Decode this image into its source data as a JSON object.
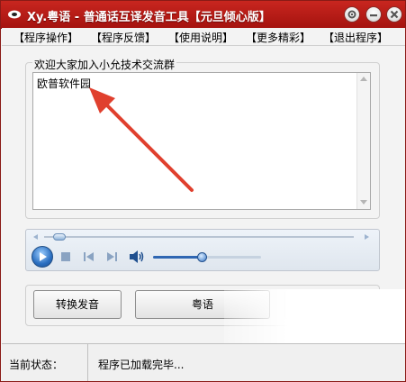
{
  "window": {
    "title": "Xy.粤语 - 普通话互译发音工具【元旦倾心版】",
    "accent_color": "#b51b16",
    "controls": [
      "settings-icon",
      "minimize-icon",
      "close-icon"
    ]
  },
  "menu": {
    "items": [
      "【程序操作】",
      "【程序反馈】",
      "【使用说明】",
      "【更多精彩】",
      "【退出程序】"
    ]
  },
  "input_group": {
    "label": "欢迎大家加入小允技术交流群",
    "text": "欧普软件园"
  },
  "player": {
    "progress": 0.0,
    "volume": 0.45,
    "icons": [
      "play-icon",
      "stop-icon",
      "previous-icon",
      "next-icon",
      "volume-icon"
    ]
  },
  "buttons": {
    "convert_label": "转换发音",
    "cantonese_label": "粤语"
  },
  "status": {
    "label": "当前状态：",
    "value": "程序已加载完毕..."
  }
}
